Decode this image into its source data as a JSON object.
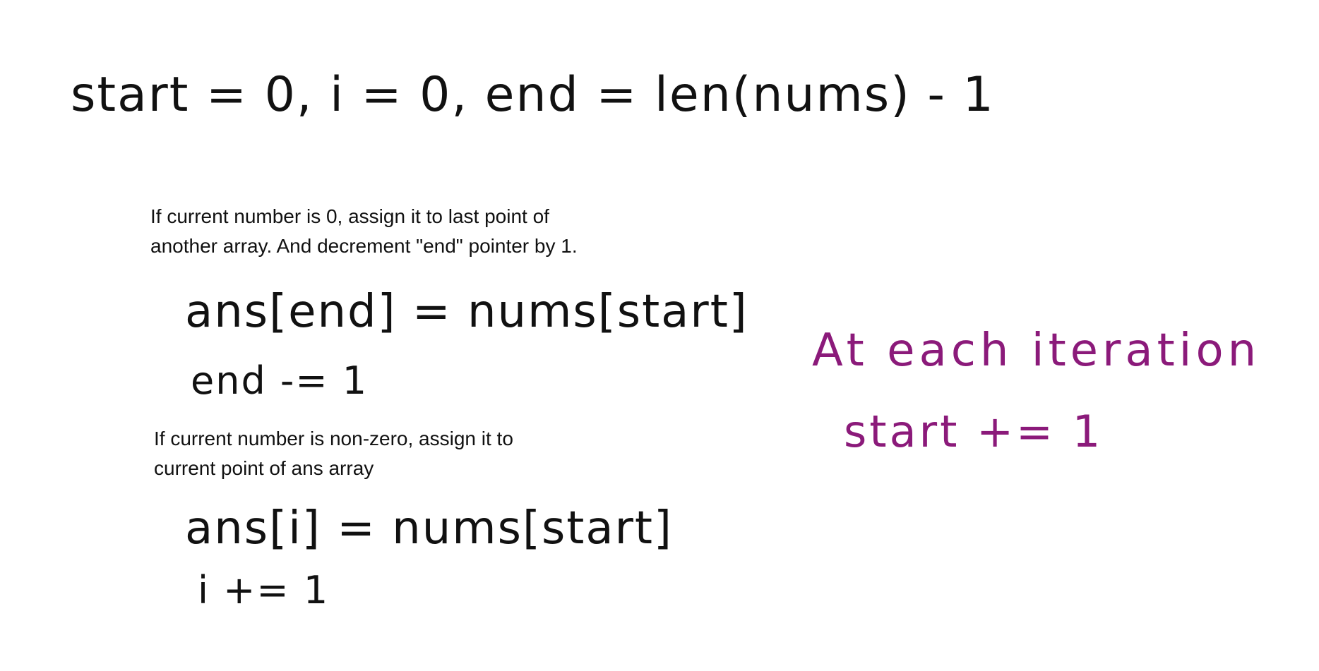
{
  "handwritten": {
    "init_line": "start = 0, i = 0, end = len(nums) - 1",
    "zero_assign": "ans[end] = nums[start]",
    "zero_decrement": "end -= 1",
    "nonzero_assign": "ans[i] = nums[start]",
    "nonzero_increment": "i += 1",
    "iteration_heading": "At each iteration",
    "iteration_step": "start += 1"
  },
  "notes": {
    "zero_case": {
      "line1": "If current number is 0, assign it to last point of",
      "line2": "another array. And decrement \"end\" pointer by 1."
    },
    "nonzero_case": {
      "line1": "If current number is non-zero, assign it to",
      "line2": "current point of ans array"
    }
  },
  "colors": {
    "ink": "#111111",
    "purple_ink": "#8b1a7a",
    "background": "#ffffff"
  }
}
